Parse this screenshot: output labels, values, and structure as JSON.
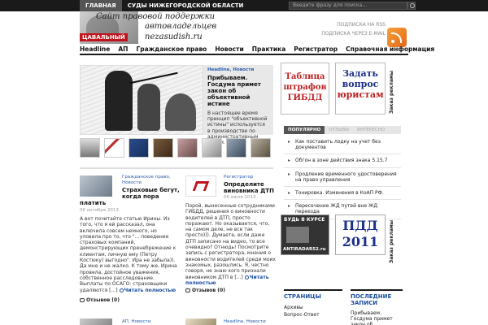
{
  "topbar": {
    "nav": [
      {
        "label": "ГЛАВНАЯ",
        "active": true
      },
      {
        "label": "СУДЫ НИЖЕГОРОДСКОЙ ОБЛАСТИ",
        "active": false
      }
    ],
    "search_placeholder": "Введите фразу для поиска..."
  },
  "header": {
    "logo_line1": "Сайт правовой поддержки",
    "logo_line2": "автовладельцев",
    "logo_line3": "nezasudish.ru",
    "logo_red": "ЦАВАЛЬНЫЙ",
    "subscribe_rss": "ПОДПИСКА НА RSS",
    "subscribe_email": "ПОДПИСКА ЧЕРЕЗ E-MAIL"
  },
  "mainnav": [
    "Headline",
    "АП",
    "Гражданское право",
    "Новости",
    "Практика",
    "Регистратор",
    "Справочная информация"
  ],
  "featured": {
    "category": "Headline, Новости",
    "title": "Прибываем. Госдума примет закон об объективной истине",
    "text": "В настоящее время принцип \"объективной истины\" используется в производстве по административным делам. Когда"
  },
  "posts": [
    {
      "category": "Гражданское право, Новости",
      "title": "Страховые бегут, когда пора",
      "title2": "платить",
      "date": "06 октября 2013",
      "body": "А вот почитайте статью Ирины. Из того, что я ей рассказал, она включила совсем немного, но уловила про то, что \"... поведение страховых компаний, демонстрирующих пренебрежение к клиентам, личную ему (Петру Костюку) выгодно\". Ира не забыла)). Да мне и не жалко. К тому же, Ирина провела, достойное уважения, собственное расследование. Выплаты по ОСАГО: страховщики удаляются [...]",
      "more": "Читать полностью",
      "comments": "Отзывов (0)"
    },
    {
      "category": "Регистратор",
      "title": "Определите виновника ДТП",
      "date": "06 июля 2013",
      "body": "Порой, вынесенные сотрудниками ГИБДД, решения о виновности водителей в ДТП, просто поражают. Но оказывается, что, на самом деле, не все так просто))). Думаете, если даже ДТП записано на видео, то все очевидно? Отнюдь! Посмотрите запись с регистратора, мнения о виновности водителей среди моих знакомых, разошлись. Я, честно говоря, не знаю кого признали виновником ДТП в [...]",
      "more": "Читать полностью",
      "comments": "Отзывов (0)"
    },
    {
      "category": "АП, Новости"
    },
    {
      "category": "Headline, Новости"
    }
  ],
  "ads": {
    "ad1": "Таблица штрафов ГИБДД",
    "ad2_line1": "Задать",
    "ad2_line2": "вопрос",
    "ad2_line3": "юристам",
    "vertical_label": "Заказ рекламы",
    "ad3_top": "БУДЬ В КУРСЕ",
    "ad3_bottom": "ANTIRADAR52.ru",
    "ad4_line1": "ПДД",
    "ad4_line2": "2011"
  },
  "tabs": [
    {
      "label": "ПОПУЛЯРНО",
      "active": true
    },
    {
      "label": "ОТЗЫВЫ",
      "active": false
    },
    {
      "label": "ИНТЕРЕСНО",
      "active": false
    }
  ],
  "popular": [
    "Как поставить лодку на учет без документов",
    "Обгон в зоне действия знака 5.15.7",
    "Продление временного удостоверения на право управления",
    "Тонировка. Изменения в КоАП РФ.",
    "Пересечение ЖД путей вне ЖД переезда"
  ],
  "pages_box": {
    "title": "СТРАНИЦЫ",
    "items": [
      "Архивы",
      "Вопрос-Ответ"
    ]
  },
  "latest_box": {
    "title": "ПОСЛЕДНИЕ ЗАПИСИ",
    "first": "Прибываем. Госдума примет закон об"
  },
  "colors": {
    "topbar": "#1a1a1a",
    "link_blue": "#1a4fa0",
    "red": "#c0141c"
  }
}
